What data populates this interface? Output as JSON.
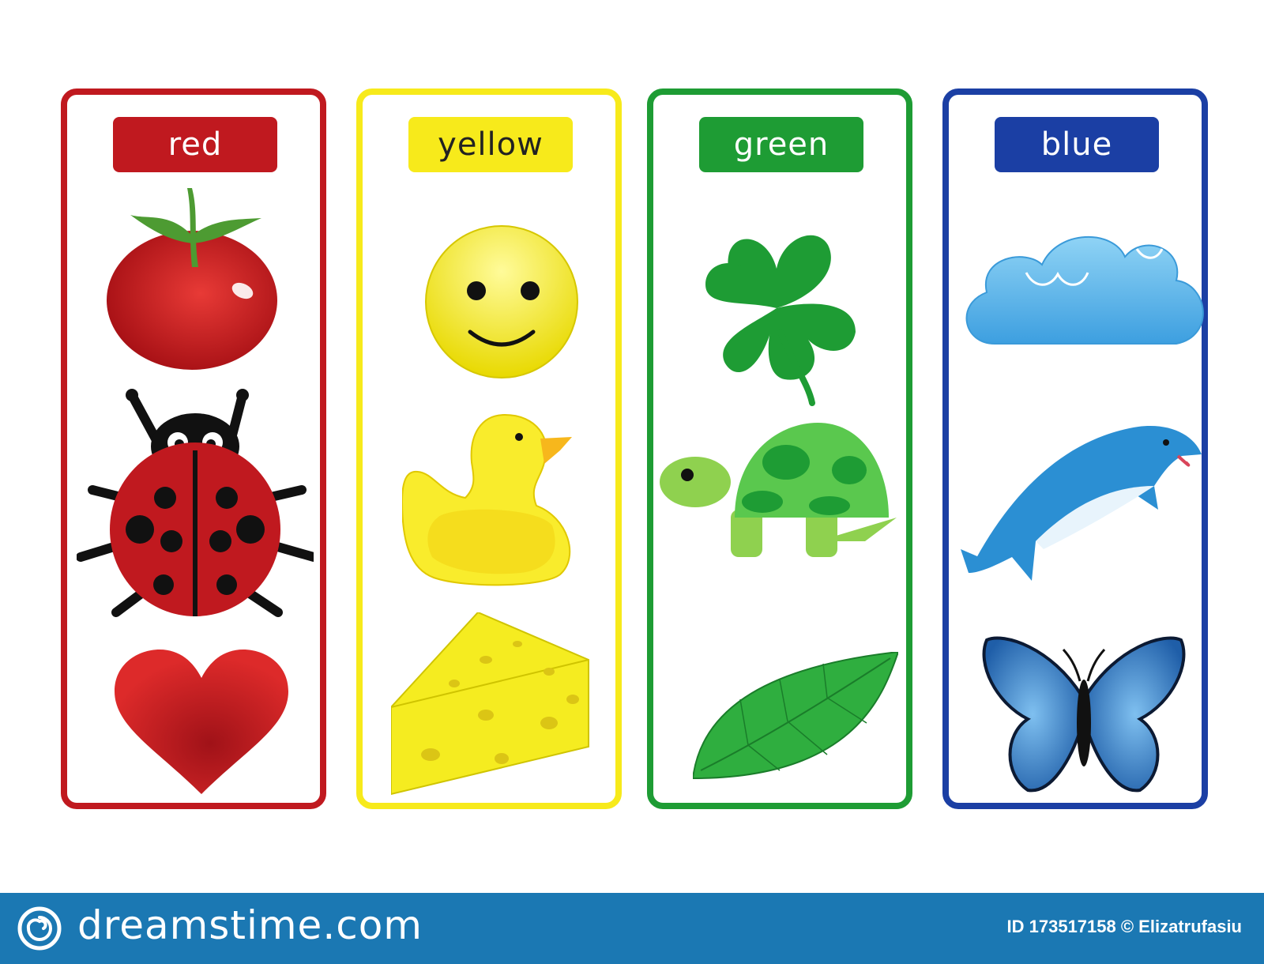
{
  "cards": [
    {
      "label": "red",
      "border": "#c0191f",
      "label_bg": "#c0191f",
      "label_color": "#ffffff",
      "items": [
        "tomato-icon",
        "ladybug-icon",
        "heart-icon"
      ]
    },
    {
      "label": "yellow",
      "border": "#f7ea1b",
      "label_bg": "#f7ea1b",
      "label_color": "#222222",
      "items": [
        "smiley-face-icon",
        "rubber-duck-icon",
        "cheese-icon"
      ]
    },
    {
      "label": "green",
      "border": "#1e9c34",
      "label_bg": "#1e9c34",
      "label_color": "#ffffff",
      "items": [
        "four-leaf-clover-icon",
        "turtle-icon",
        "leaf-icon"
      ]
    },
    {
      "label": "blue",
      "border": "#1b3fa4",
      "label_bg": "#1b3fa4",
      "label_color": "#ffffff",
      "items": [
        "cloud-icon",
        "dolphin-icon",
        "butterfly-icon"
      ]
    }
  ],
  "footer": {
    "brand": "dreamstime.com",
    "credit": "ID 173517158 © Elizatrufasiu",
    "background": "#1b78b3"
  }
}
